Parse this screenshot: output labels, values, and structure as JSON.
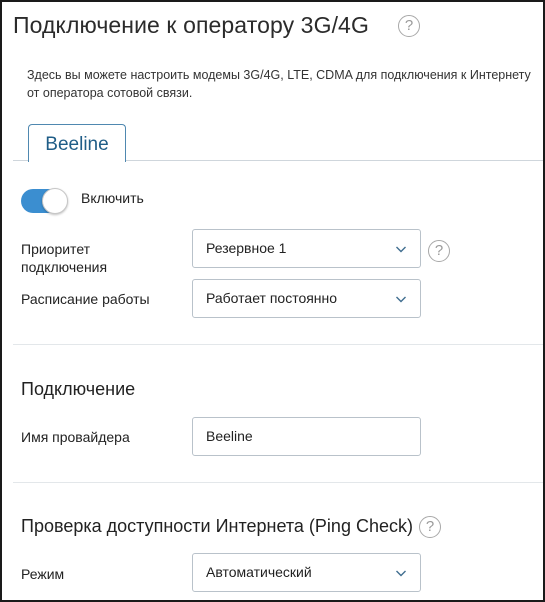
{
  "page": {
    "title": "Подключение к оператору 3G/4G",
    "help_glyph": "?",
    "description": "Здесь вы можете настроить модемы 3G/4G, LTE, CDMA для подключения к Интернету от оператора сотовой связи."
  },
  "tabs": [
    {
      "label": "Beeline",
      "active": true
    }
  ],
  "enable": {
    "label": "Включить",
    "checked": true
  },
  "fields": {
    "priority": {
      "label": "Приоритет подключения",
      "value": "Резервное 1"
    },
    "schedule": {
      "label": "Расписание работы",
      "value": "Работает постоянно"
    }
  },
  "connection": {
    "heading": "Подключение",
    "provider_label": "Имя провайдера",
    "provider_value": "Beeline"
  },
  "ping_check": {
    "heading": "Проверка доступности Интернета (Ping Check)",
    "mode_label": "Режим",
    "mode_value": "Автоматический"
  },
  "colors": {
    "accent": "#3b8ed0",
    "tab_text": "#1f5d87",
    "border": "#b9c2ca"
  },
  "icons": {
    "help": "question-circle-icon",
    "dropdown": "chevron-down-icon"
  }
}
